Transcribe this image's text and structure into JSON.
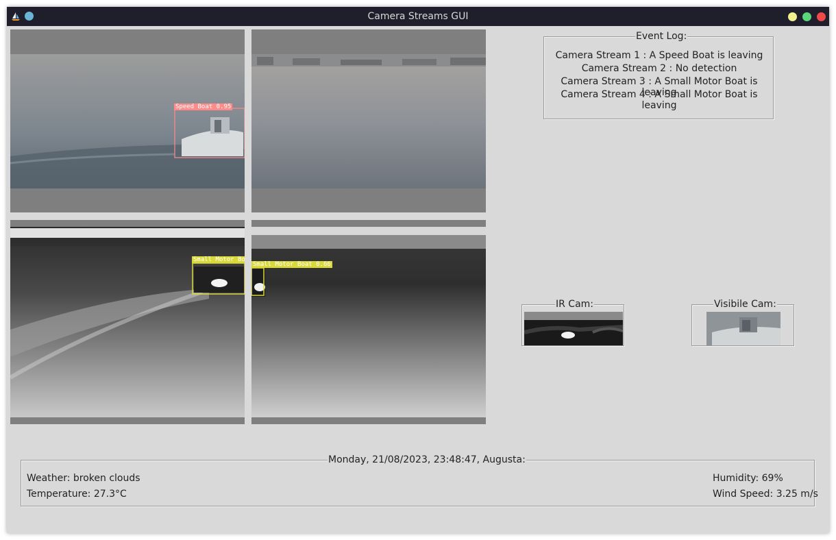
{
  "window": {
    "title": "Camera Streams GUI"
  },
  "streams": [
    {
      "name": "Camera Stream 1",
      "detection_label": "Speed Boat 0.95"
    },
    {
      "name": "Camera Stream 2",
      "detection_label": ""
    },
    {
      "name": "Camera Stream 3",
      "detection_label": "Small Motor Bo"
    },
    {
      "name": "Camera Stream 4",
      "detection_label": "Small Motor Boat 0.66"
    }
  ],
  "event_log": {
    "title": "Event Log:",
    "lines": [
      "Camera Stream 1 : A Speed Boat is leaving",
      "Camera Stream 2 : No detection",
      "Camera Stream 3 : A Small Motor Boat is leaving",
      "Camera Stream 4 : A Small Motor Boat is leaving"
    ]
  },
  "ir_cam": {
    "title": "IR Cam:"
  },
  "visible_cam": {
    "title": "Visibile Cam:"
  },
  "info_panel": {
    "title": "Monday, 21/08/2023, 23:48:47, Augusta:",
    "weather": "Weather: broken clouds",
    "temperature": "Temperature: 27.3°C",
    "humidity": "Humidity: 69%",
    "wind_speed": "Wind Speed: 3.25 m/s"
  },
  "colors": {
    "titlebar": "#1f1f2b",
    "window_bg": "#d9d9d9",
    "detection_red": "#ff8a8a",
    "detection_yellow": "#d9d93a"
  }
}
